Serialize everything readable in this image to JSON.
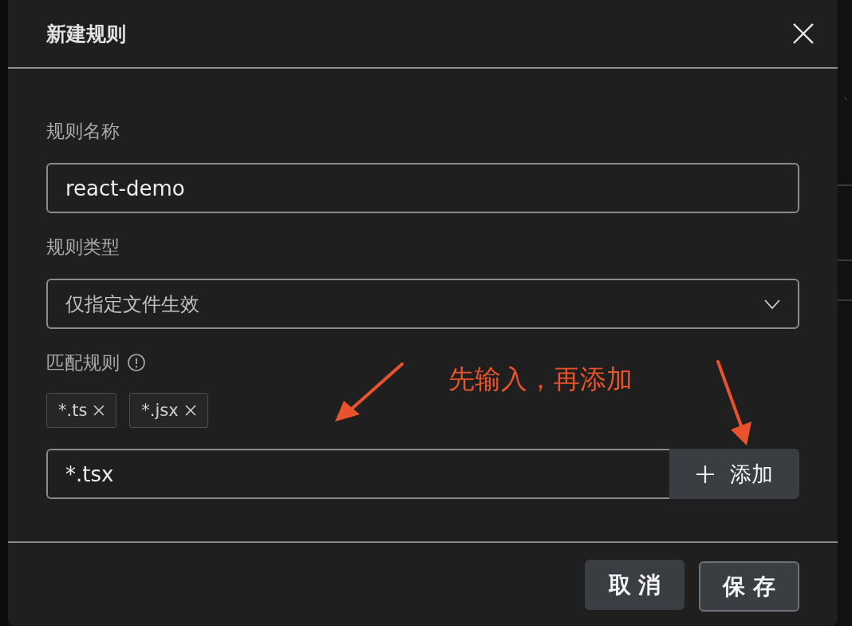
{
  "dialog": {
    "title": "新建规则"
  },
  "form": {
    "fields": [
      {
        "kind": "input",
        "label": "规则名称",
        "value": "react-demo"
      },
      {
        "kind": "select",
        "label": "规则类型",
        "value": "仅指定文件生效"
      },
      {
        "kind": "tags",
        "label": "匹配规则",
        "info": true,
        "tags": [
          "*.ts",
          "*.jsx"
        ],
        "input_value": "*.tsx",
        "add_button": "添加"
      }
    ]
  },
  "annotation": {
    "text": "先输入，再添加"
  },
  "footer": {
    "buttons": [
      {
        "label": "取 消",
        "focused": false
      },
      {
        "label": "保 存",
        "focused": true
      }
    ]
  },
  "backdrop": {
    "texts": [
      "、"
    ]
  }
}
